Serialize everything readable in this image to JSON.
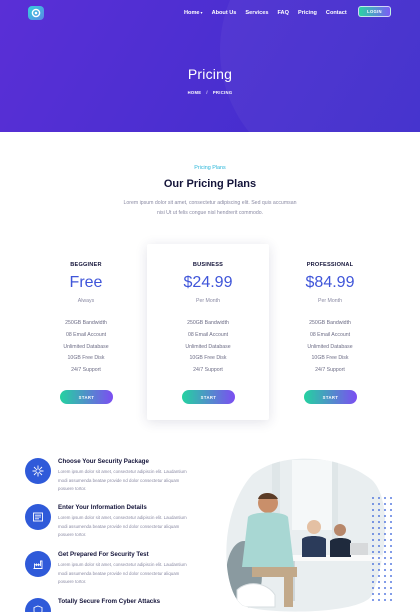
{
  "header": {
    "nav": [
      {
        "label": "Home",
        "has_caret": true
      },
      {
        "label": "About Us"
      },
      {
        "label": "Services"
      },
      {
        "label": "FAQ"
      },
      {
        "label": "Pricing"
      },
      {
        "label": "Contact"
      }
    ],
    "caret": "▾",
    "login_label": "LOGIN"
  },
  "hero": {
    "title": "Pricing",
    "breadcrumb": {
      "home": "HOME",
      "sep": "/",
      "current": "PRICING"
    }
  },
  "pricing_section": {
    "eyebrow": "Pricing Plans",
    "title": "Our Pricing Plans",
    "description": "Lorem ipsum dolor sit amet, consectetur adipiscing elit. Sed quis accumsan nisi Ut ut felis congue nisl hendrerit commodo."
  },
  "plans": [
    {
      "name": "BEGGINER",
      "price": "Free",
      "period": "Always",
      "features": [
        "250GB Bandwidth",
        "08 Email Account",
        "Unlimited Database",
        "10GB Free Disk",
        "24/7 Support"
      ],
      "button": "START",
      "featured": false
    },
    {
      "name": "BUSINESS",
      "price": "$24.99",
      "period": "Per Month",
      "features": [
        "250GB Bandwidth",
        "08 Email Account",
        "Unlimited Database",
        "10GB Free Disk",
        "24/7 Support"
      ],
      "button": "START",
      "featured": true
    },
    {
      "name": "PROFESSIONAL",
      "price": "$84.99",
      "period": "Per Month",
      "features": [
        "250GB Bandwidth",
        "08 Email Account",
        "Unlimited Database",
        "10GB Free Disk",
        "24/7 Support"
      ],
      "button": "START",
      "featured": false
    }
  ],
  "features": [
    {
      "icon": "security-package-icon",
      "title": "Choose Your Security Package",
      "text": "Lorem ipsum dolor sit amet, consectetur adipiscin elit. Laudantium modi assumenda beatae provide nd dolor consectetur aliquam posuere tortor."
    },
    {
      "icon": "information-details-icon",
      "title": "Enter Your Information Details",
      "text": "Lorem ipsum dolor sit amet, consectetur adipiscin elit. Laudantium modi assumenda beatae provide nd dolor consectetur aliquam posuere tortor."
    },
    {
      "icon": "security-test-icon",
      "title": "Get Prepared For Security Test",
      "text": "Lorem ipsum dolor sit amet, consectetur adipiscin elit. Laudantium modi assumenda beatae provide nd dolor consectetur aliquam posuere tortor."
    },
    {
      "icon": "cyber-shield-icon",
      "title": "Totally Secure From Cyber Attacks",
      "text": ""
    }
  ],
  "colors": {
    "hero_gradient_start": "#5a2fd6",
    "hero_gradient_end": "#3f2ccc",
    "accent_blue": "#3f55d9",
    "eyebrow_cyan": "#2ab6d9",
    "button_gradient_start": "#24d2a0",
    "button_gradient_end": "#7c4df2"
  }
}
